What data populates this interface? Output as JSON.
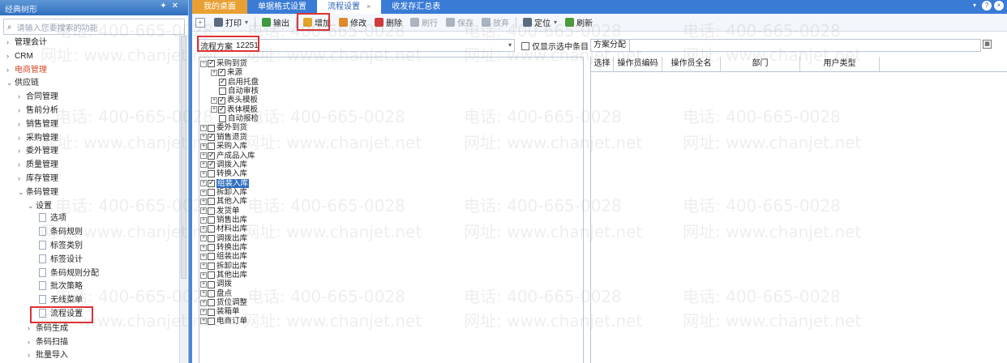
{
  "left_panel": {
    "title": "经典树形",
    "search_placeholder": "请输入您要搜索的功能",
    "nav": [
      {
        "label": "管理会计",
        "arrow": "›",
        "indent": 0
      },
      {
        "label": "CRM",
        "arrow": "›",
        "indent": 0
      },
      {
        "label": "电商管理",
        "arrow": "›",
        "indent": 0,
        "highlight": true
      },
      {
        "label": "供应链",
        "arrow": "⌄",
        "indent": 0
      },
      {
        "label": "合同管理",
        "arrow": "›",
        "indent": 1
      },
      {
        "label": "售前分析",
        "arrow": "›",
        "indent": 1
      },
      {
        "label": "销售管理",
        "arrow": "›",
        "indent": 1
      },
      {
        "label": "采购管理",
        "arrow": "›",
        "indent": 1
      },
      {
        "label": "委外管理",
        "arrow": "›",
        "indent": 1
      },
      {
        "label": "质量管理",
        "arrow": "›",
        "indent": 1
      },
      {
        "label": "库存管理",
        "arrow": "›",
        "indent": 1
      },
      {
        "label": "条码管理",
        "arrow": "⌄",
        "indent": 1
      },
      {
        "label": "设置",
        "arrow": "⌄",
        "indent": 2
      },
      {
        "label": "选项",
        "arrow": "",
        "indent": 3,
        "doc": true
      },
      {
        "label": "条码规则",
        "arrow": "",
        "indent": 3,
        "doc": true
      },
      {
        "label": "标签类别",
        "arrow": "",
        "indent": 3,
        "doc": true
      },
      {
        "label": "标签设计",
        "arrow": "",
        "indent": 3,
        "doc": true
      },
      {
        "label": "条码规则分配",
        "arrow": "",
        "indent": 3,
        "doc": true
      },
      {
        "label": "批次策略",
        "arrow": "",
        "indent": 3,
        "doc": true
      },
      {
        "label": "无线菜单",
        "arrow": "",
        "indent": 3,
        "doc": true
      },
      {
        "label": "流程设置",
        "arrow": "",
        "indent": 3,
        "doc": true,
        "boxed": true
      },
      {
        "label": "条码生成",
        "arrow": "›",
        "indent": 2
      },
      {
        "label": "条码扫描",
        "arrow": "›",
        "indent": 2
      },
      {
        "label": "批量导入",
        "arrow": "›",
        "indent": 2
      }
    ]
  },
  "tabs": [
    {
      "label": "我的桌面",
      "kind": "home"
    },
    {
      "label": "单据格式设置",
      "kind": "normal"
    },
    {
      "label": "流程设置",
      "kind": "active",
      "close": "×"
    },
    {
      "label": "收发存汇总表",
      "kind": "normal"
    }
  ],
  "window_icons": {
    "dropdown": "▾",
    "help": "?",
    "close": "×"
  },
  "toolbar": [
    {
      "label": "打印",
      "color": "#5a6b80",
      "dropdown": "▾"
    },
    {
      "label": "输出",
      "color": "#3d9a3d"
    },
    {
      "label": "增加",
      "color": "#e2a52a",
      "boxed": true
    },
    {
      "label": "修改",
      "color": "#e08a2a"
    },
    {
      "label": "删除",
      "color": "#d03a3a"
    },
    {
      "label": "刷行",
      "color": "#aab4c0",
      "disabled": true
    },
    {
      "label": "保存",
      "color": "#aab4c0",
      "disabled": true
    },
    {
      "label": "放弃",
      "color": "#aab4c0",
      "disabled": true
    },
    {
      "label": "定位",
      "color": "#5a6b80",
      "dropdown": "▾"
    },
    {
      "label": "刷新",
      "color": "#4a9a3a"
    }
  ],
  "plan": {
    "label": "流程方案",
    "value": "12251",
    "dropdown": "▾"
  },
  "only_selected_label": "仅显示选中条目",
  "assign": {
    "label": "方案分配",
    "grid_icon": "▦"
  },
  "table_headers": [
    "选择",
    "操作员编码",
    "操作员全名",
    "部门",
    "用户类型"
  ],
  "process_tree": [
    {
      "label": "采购到货",
      "exp": "−",
      "checked": true,
      "level": 0
    },
    {
      "label": "来源",
      "exp": "+",
      "checked": true,
      "level": 1
    },
    {
      "label": "启用托盘",
      "exp": "",
      "checked": true,
      "level": 1
    },
    {
      "label": "自动审核",
      "exp": "",
      "checked": false,
      "level": 1
    },
    {
      "label": "表头模板",
      "exp": "+",
      "checked": true,
      "level": 1
    },
    {
      "label": "表体模板",
      "exp": "+",
      "checked": true,
      "level": 1
    },
    {
      "label": "自动报检",
      "exp": "",
      "checked": false,
      "level": 1
    },
    {
      "label": "委外到货",
      "exp": "+",
      "checked": false,
      "level": 0
    },
    {
      "label": "销售退货",
      "exp": "+",
      "checked": true,
      "level": 0
    },
    {
      "label": "采购入库",
      "exp": "+",
      "checked": false,
      "level": 0
    },
    {
      "label": "产成品入库",
      "exp": "+",
      "checked": true,
      "level": 0
    },
    {
      "label": "调拨入库",
      "exp": "+",
      "checked": true,
      "level": 0
    },
    {
      "label": "转换入库",
      "exp": "+",
      "checked": false,
      "level": 0
    },
    {
      "label": "组装入库",
      "exp": "+",
      "checked": true,
      "level": 0,
      "selected": true
    },
    {
      "label": "拆卸入库",
      "exp": "+",
      "checked": false,
      "level": 0
    },
    {
      "label": "其他入库",
      "exp": "+",
      "checked": false,
      "level": 0
    },
    {
      "label": "发货单",
      "exp": "+",
      "checked": false,
      "level": 0
    },
    {
      "label": "销售出库",
      "exp": "+",
      "checked": false,
      "level": 0
    },
    {
      "label": "材料出库",
      "exp": "+",
      "checked": false,
      "level": 0
    },
    {
      "label": "调拨出库",
      "exp": "+",
      "checked": false,
      "level": 0
    },
    {
      "label": "转换出库",
      "exp": "+",
      "checked": false,
      "level": 0
    },
    {
      "label": "组装出库",
      "exp": "+",
      "checked": false,
      "level": 0
    },
    {
      "label": "拆卸出库",
      "exp": "+",
      "checked": false,
      "level": 0
    },
    {
      "label": "其他出库",
      "exp": "+",
      "checked": false,
      "level": 0
    },
    {
      "label": "调拨",
      "exp": "+",
      "checked": false,
      "level": 0
    },
    {
      "label": "盘点",
      "exp": "+",
      "checked": false,
      "level": 0
    },
    {
      "label": "货位调整",
      "exp": "+",
      "checked": false,
      "level": 0
    },
    {
      "label": "装箱单",
      "exp": "+",
      "checked": false,
      "level": 0
    },
    {
      "label": "电商订单",
      "exp": "+",
      "checked": false,
      "level": 0
    }
  ],
  "watermark": {
    "phone": "电话: 400-665-0028",
    "site": "网址: www.chanjet.net"
  }
}
